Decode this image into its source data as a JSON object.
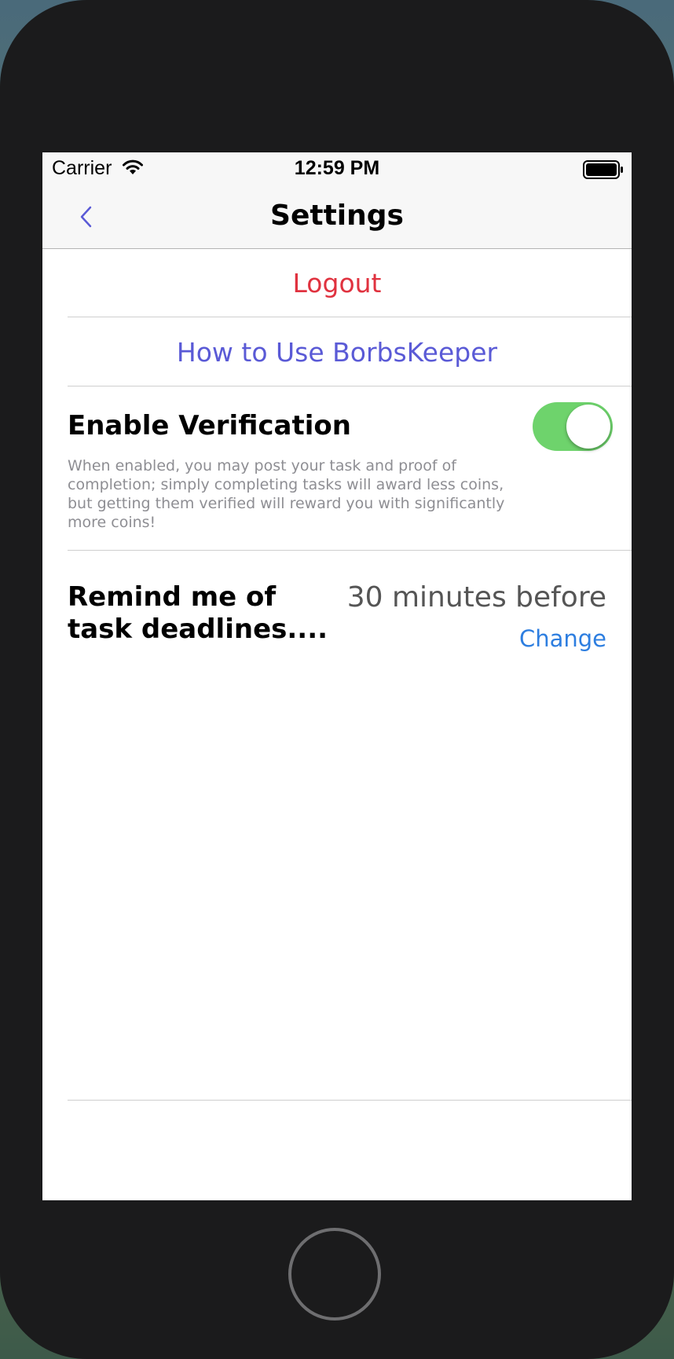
{
  "status_bar": {
    "carrier": "Carrier",
    "time": "12:59 PM"
  },
  "nav": {
    "title": "Settings",
    "back_icon": "chevron-left-icon"
  },
  "settings": {
    "logout_label": "Logout",
    "howto_label": "How to Use BorbsKeeper",
    "verification": {
      "title": "Enable Verification",
      "description": "When enabled, you may post your task and proof of completion; simply completing tasks will award less coins, but getting them verified will reward you with significantly more coins!",
      "enabled": true
    },
    "reminder": {
      "title": "Remind me of task deadlines....",
      "value": "30 minutes before",
      "change_label": "Change"
    }
  },
  "colors": {
    "logout": "#e0323f",
    "link": "#5a5ad6",
    "toggle_on": "#6ed36c",
    "change": "#2d7ee0"
  }
}
